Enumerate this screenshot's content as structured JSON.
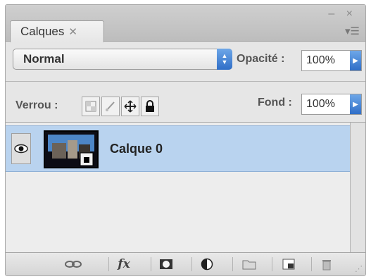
{
  "panel": {
    "tab_label": "Calques",
    "tab_close": "✕",
    "window_controls": "– ×",
    "menu_icon": "flyout-menu-icon"
  },
  "blend": {
    "value": "Normal"
  },
  "opacity": {
    "label": "Opacité :",
    "value": "100%"
  },
  "lock": {
    "label": "Verrou :",
    "buttons": [
      "lock-transparency-icon",
      "lock-pixels-icon",
      "lock-position-icon",
      "lock-all-icon"
    ]
  },
  "fill": {
    "label": "Fond :",
    "value": "100%"
  },
  "layers": [
    {
      "name": "Calque 0",
      "visible": true,
      "selected": true
    }
  ],
  "footer": {
    "buttons": [
      "link-icon",
      "fx-icon",
      "mask-icon",
      "adjustment-icon",
      "folder-icon",
      "new-layer-icon",
      "trash-icon"
    ],
    "fx_label": "fx"
  },
  "colors": {
    "selection": "#b9d3ef",
    "accent": "#3a7bd5"
  }
}
